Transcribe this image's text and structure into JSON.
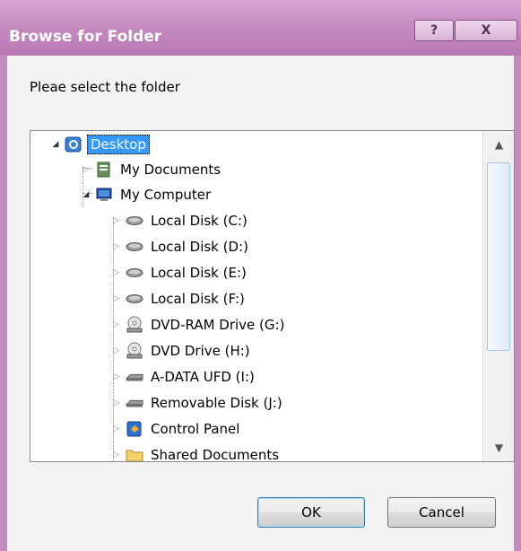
{
  "window": {
    "title": "Browse for Folder",
    "help_label": "?",
    "close_label": "X"
  },
  "prompt": "Pleae select the folder",
  "tree": {
    "items": [
      {
        "label": "Desktop",
        "icon": "desktop-icon",
        "selected": true
      },
      {
        "label": "My Documents",
        "icon": "documents-folder-icon"
      },
      {
        "label": "My Computer",
        "icon": "computer-icon"
      },
      {
        "label": "Local Disk (C:)",
        "icon": "hard-disk-icon"
      },
      {
        "label": "Local Disk (D:)",
        "icon": "hard-disk-icon"
      },
      {
        "label": "Local Disk (E:)",
        "icon": "hard-disk-icon"
      },
      {
        "label": "Local Disk (F:)",
        "icon": "hard-disk-icon"
      },
      {
        "label": "DVD-RAM Drive (G:)",
        "icon": "dvd-drive-icon"
      },
      {
        "label": "DVD Drive (H:)",
        "icon": "dvd-drive-icon"
      },
      {
        "label": "A-DATA UFD (I:)",
        "icon": "removable-drive-icon"
      },
      {
        "label": "Removable Disk (J:)",
        "icon": "removable-drive-icon"
      },
      {
        "label": "Control Panel",
        "icon": "control-panel-icon"
      },
      {
        "label": "Shared Documents",
        "icon": "folder-icon"
      }
    ]
  },
  "buttons": {
    "ok": "OK",
    "cancel": "Cancel"
  }
}
